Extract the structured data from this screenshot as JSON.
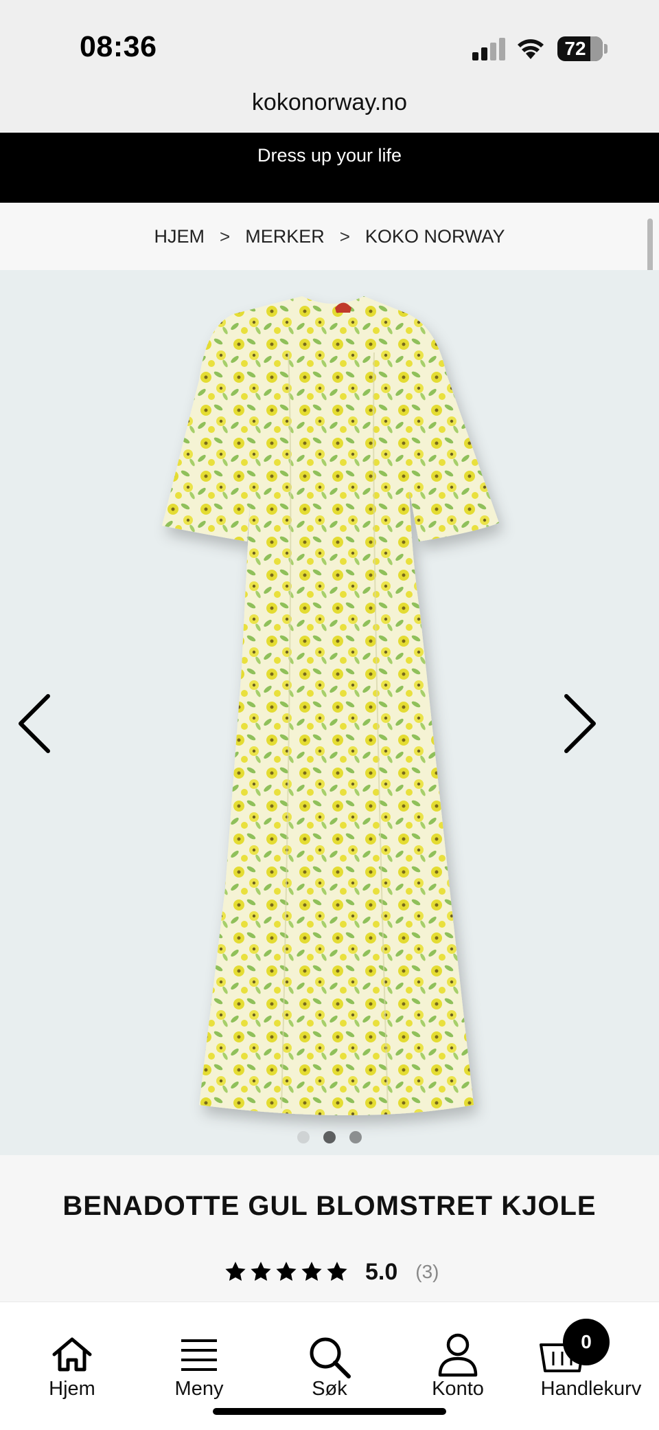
{
  "status_bar": {
    "time": "08:36",
    "battery": "72"
  },
  "browser": {
    "url": "kokonorway.no"
  },
  "promo": {
    "text": "Dress up your life"
  },
  "breadcrumb": {
    "items": [
      "HJEM",
      "MERKER",
      "KOKO NORWAY"
    ],
    "separator": ">"
  },
  "gallery": {
    "image_count": 3,
    "active_index": 1
  },
  "product": {
    "title": "BENADOTTE GUL BLOMSTRET KJOLE",
    "rating_value": "5.0",
    "rating_count": "(3)",
    "stars": 5
  },
  "bottom_nav": {
    "items": [
      {
        "label": "Hjem",
        "icon": "home-icon"
      },
      {
        "label": "Meny",
        "icon": "menu-icon"
      },
      {
        "label": "Søk",
        "icon": "search-icon"
      },
      {
        "label": "Konto",
        "icon": "account-icon"
      },
      {
        "label": "Handlekurv",
        "icon": "cart-icon"
      }
    ],
    "cart_count": "0"
  },
  "colors": {
    "banner": "#000000",
    "gallery_bg": "#e8eeef",
    "dress_base": "#f4f1cf",
    "flower": "#e6df3a",
    "leaf": "#8fc05a"
  }
}
